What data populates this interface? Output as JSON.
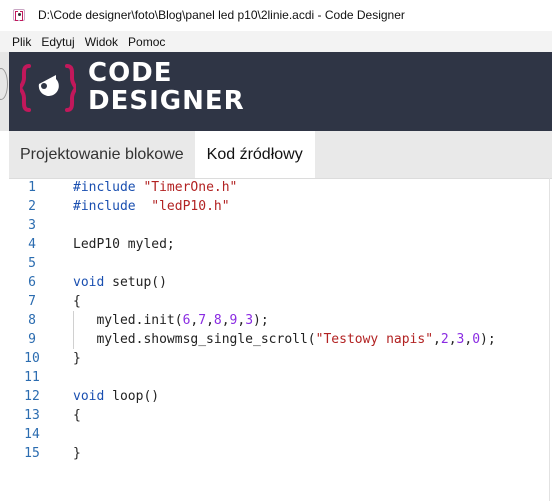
{
  "window": {
    "title": "D:\\Code designer\\foto\\Blog\\panel led p10\\2linie.acdi - Code Designer"
  },
  "menu": [
    "Plik",
    "Edytuj",
    "Widok",
    "Pomoc"
  ],
  "logo": {
    "line1": "CODE",
    "line2": "DESIGNER",
    "accent": "#c2185b"
  },
  "tabs": [
    {
      "label": "Projektowanie blokowe",
      "active": false
    },
    {
      "label": "Kod źródłowy",
      "active": true
    }
  ],
  "code": {
    "lines": [
      {
        "n": "1",
        "tokens": [
          {
            "t": "#include",
            "c": "kw"
          },
          {
            "t": " "
          },
          {
            "t": "\"TimerOne.h\"",
            "c": "str"
          }
        ]
      },
      {
        "n": "2",
        "tokens": [
          {
            "t": "#include",
            "c": "kw"
          },
          {
            "t": "  "
          },
          {
            "t": "\"ledP10.h\"",
            "c": "str"
          }
        ]
      },
      {
        "n": "3",
        "tokens": []
      },
      {
        "n": "4",
        "tokens": [
          {
            "t": "LedP10 myled;"
          }
        ]
      },
      {
        "n": "5",
        "tokens": []
      },
      {
        "n": "6",
        "tokens": [
          {
            "t": "void",
            "c": "kw"
          },
          {
            "t": " setup()"
          }
        ]
      },
      {
        "n": "7",
        "tokens": [
          {
            "t": "{"
          }
        ]
      },
      {
        "n": "8",
        "tokens": [
          {
            "t": "   myled.init("
          },
          {
            "t": "6",
            "c": "num"
          },
          {
            "t": ","
          },
          {
            "t": "7",
            "c": "num"
          },
          {
            "t": ","
          },
          {
            "t": "8",
            "c": "num"
          },
          {
            "t": ","
          },
          {
            "t": "9",
            "c": "num"
          },
          {
            "t": ","
          },
          {
            "t": "3",
            "c": "num"
          },
          {
            "t": ");"
          }
        ]
      },
      {
        "n": "9",
        "tokens": [
          {
            "t": "   myled.showmsg_single_scroll("
          },
          {
            "t": "\"Testowy napis\"",
            "c": "str"
          },
          {
            "t": ","
          },
          {
            "t": "2",
            "c": "num"
          },
          {
            "t": ","
          },
          {
            "t": "3",
            "c": "num"
          },
          {
            "t": ","
          },
          {
            "t": "0",
            "c": "num"
          },
          {
            "t": ");"
          }
        ]
      },
      {
        "n": "10",
        "tokens": [
          {
            "t": "}"
          }
        ]
      },
      {
        "n": "11",
        "tokens": []
      },
      {
        "n": "12",
        "tokens": [
          {
            "t": "void",
            "c": "kw"
          },
          {
            "t": " loop()"
          }
        ]
      },
      {
        "n": "13",
        "tokens": [
          {
            "t": "{"
          }
        ]
      },
      {
        "n": "14",
        "tokens": []
      },
      {
        "n": "15",
        "tokens": [
          {
            "t": "}"
          }
        ]
      }
    ]
  }
}
